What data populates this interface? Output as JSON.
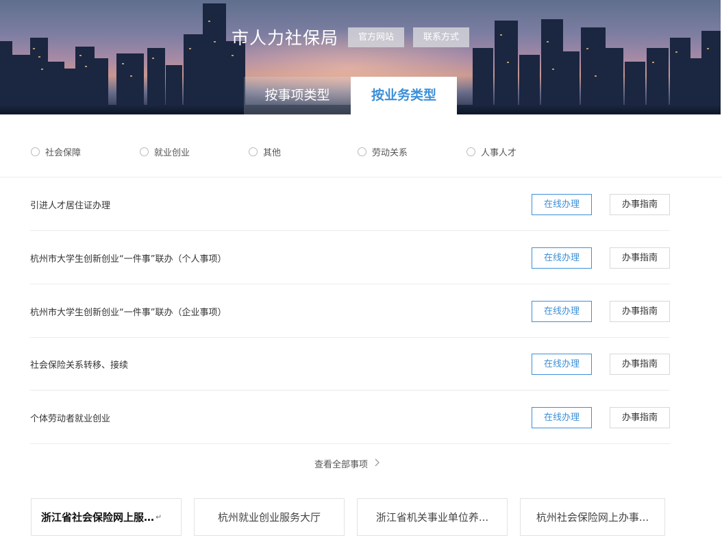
{
  "header": {
    "agency_title": "市人力社保局",
    "official_site_label": "官方网站",
    "contact_label": "联系方式"
  },
  "tabs": [
    {
      "label": "按事项类型",
      "active": false
    },
    {
      "label": "按业务类型",
      "active": true
    }
  ],
  "filters": [
    {
      "label": "社会保障",
      "checked": false
    },
    {
      "label": "就业创业",
      "checked": false
    },
    {
      "label": "其他",
      "checked": false
    },
    {
      "label": "劳动关系",
      "checked": false
    },
    {
      "label": "人事人才",
      "checked": false
    }
  ],
  "items": [
    {
      "title": "引进人才居住证办理"
    },
    {
      "title": "杭州市大学生创新创业“一件事”联办（个人事项）"
    },
    {
      "title": "杭州市大学生创新创业“一件事”联办（企业事项）"
    },
    {
      "title": "社会保险关系转移、接续"
    },
    {
      "title": "个体劳动者就业创业"
    }
  ],
  "buttons": {
    "online_label": "在线办理",
    "guide_label": "办事指南"
  },
  "view_all_label": "查看全部事项",
  "quick_links": [
    {
      "label": "浙江省社会保险网上服…",
      "return_mark": "↵"
    },
    {
      "label": "杭州就业创业服务大厅"
    },
    {
      "label": "浙江省机关事业单位养..."
    },
    {
      "label": "杭州社会保险网上办事..."
    }
  ],
  "colors": {
    "accent": "#3b8fd8",
    "border": "#ececec"
  },
  "icons": {
    "view_all": "chevron-right-icon"
  }
}
